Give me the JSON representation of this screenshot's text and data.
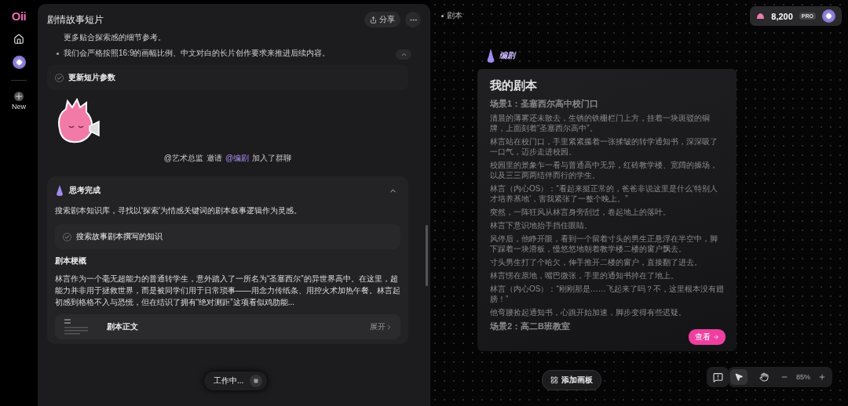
{
  "sidebar": {
    "logo": "Oii",
    "new_button": "New"
  },
  "chat": {
    "title": "剧情故事短片",
    "share_button": "分享",
    "intro_lines": [
      {
        "kind": "plain",
        "text": "更多贴合探索感的细节参考。"
      },
      {
        "kind": "bullet",
        "text": "我们会严格按照16:9的画幅比例、中文对白的长片创作要求来推进后续内容。"
      }
    ],
    "task": {
      "label": "更新短片参数",
      "done": true
    },
    "notice": {
      "inviter": "@艺术总监",
      "verb": "邀请",
      "invitee": "@编剧",
      "tail": "加入了群聊"
    },
    "thinking": {
      "title": "思考完成",
      "expanded": true,
      "summary": "搜索剧本知识库，寻找以'探索'为情感关键词的剧本叙事逻辑作为灵感。",
      "step": {
        "label": "搜索故事剧本撰写的知识",
        "done": true
      },
      "synopsis_heading": "剧本梗概",
      "synopsis": "林言作为一个毫无超能力的普通转学生，意外踏入了一所名为“圣塞西尔”的异世界高中。在这里，超能力并非用于拯救世界，而是被同学们用于日常琐事——用念力传纸条、用控火术加热午餐。林言起初感到格格不入与恐慌，但在结识了拥有“绝对测距”这项看似鸡肋能...",
      "document": {
        "title": "剧本正文",
        "action": "展开"
      }
    },
    "status": {
      "label": "工作中..."
    }
  },
  "canvas": {
    "breadcrumb": "剧本",
    "credits": "8,200",
    "plan": "PRO",
    "agent": "编剧",
    "script_card": {
      "title": "我的剧本",
      "sections": [
        {
          "heading": "场景1：圣塞西尔高中校门口",
          "paragraphs": [
            "清晨的薄雾还未散去，生锈的铁栅栏门上方，挂着一块斑驳的铜牌，上面刻着“圣塞西尔高中”。",
            "林言站在校门口，手里紧紧攥着一张揉皱的转学通知书，深深吸了一口气，迈步走进校园。",
            "校园里的景象乍一看与普通高中无异，红砖教学楼、宽阔的操场，以及三三两两结伴而行的学生。",
            "林言（内心OS）：“看起来挺正常的，爸爸非说这里是什么‘特别人才培养基地’，害我紧张了一整个晚上。”",
            "突然，一阵狂风从林言身旁刮过，卷起地上的落叶。",
            "林言下意识地抬手挡住眼睛。",
            "风停后，他睁开眼，看到一个留着寸头的男生正悬浮在半空中，脚下踩着一块滑板，慢悠悠地朝着教学楼二楼的窗户飘去。",
            "寸头男生打了个哈欠，伸手推开二楼的窗户，直接翻了进去。",
            "林言愣在原地，嘴巴微张，手里的通知书掉在了地上。",
            "林言（内心OS）：“刚刚那是……飞起来了吗？不，这里根本没有翅膀！”",
            "他弯腰捡起通知书，心跳开始加速，脚步变得有些迟疑。"
          ]
        },
        {
          "heading": "场景2：高二B班教室"
        }
      ],
      "open_button": "查看"
    },
    "add_board_button": "添加画板",
    "tools": [
      {
        "kind": "select",
        "selected": true
      },
      {
        "kind": "hand",
        "selected": false
      }
    ],
    "zoom": "85%"
  }
}
